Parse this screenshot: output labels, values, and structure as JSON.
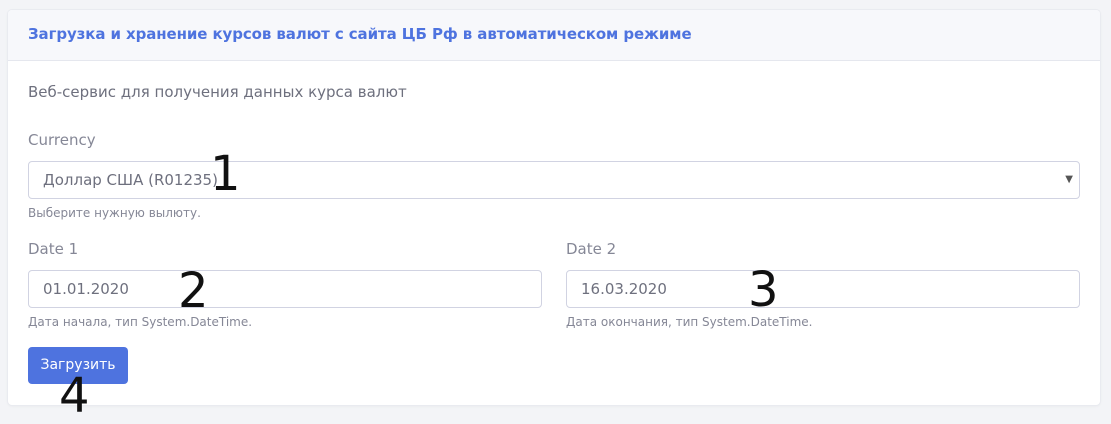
{
  "header": {
    "title": "Загрузка и хранение курсов валют с сайта ЦБ Рф в автоматическом режиме"
  },
  "form": {
    "lead": "Веб-сервис для получения данных курса валют",
    "currency": {
      "label": "Currency",
      "value": "Доллар США (R01235)",
      "help": "Выберите нужную вылюту."
    },
    "date1": {
      "label": "Date 1",
      "value": "01.01.2020",
      "help": "Дата начала, тип System.DateTime."
    },
    "date2": {
      "label": "Date 2",
      "value": "16.03.2020",
      "help": "Дата окончания, тип System.DateTime."
    },
    "submit_label": "Загрузить"
  },
  "annotations": {
    "m1": "1",
    "m2": "2",
    "m3": "3",
    "m4": "4"
  },
  "colors": {
    "accent": "#4e73df",
    "header_bg": "#f7f8fb"
  }
}
